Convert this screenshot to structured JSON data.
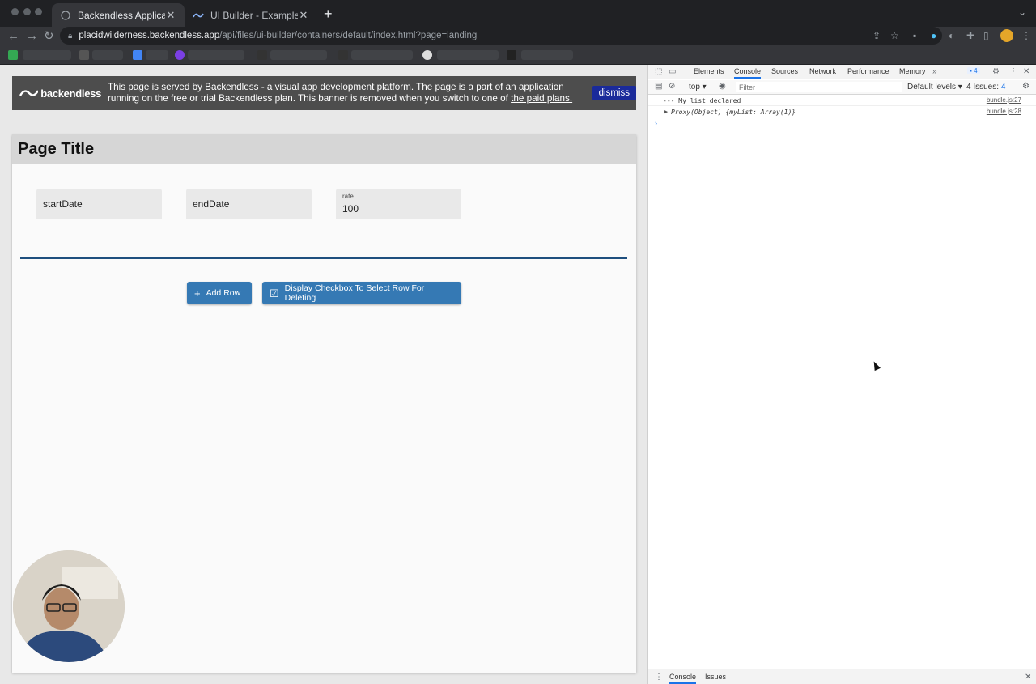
{
  "browser": {
    "tabs": [
      {
        "title": "Backendless Application",
        "active": true
      },
      {
        "title": "UI Builder - Example_for_supp",
        "active": false
      }
    ],
    "url_host": "placidwilderness.backendless.app",
    "url_path": "/api/files/ui-builder/containers/default/index.html?page=landing",
    "accent": "#35363a"
  },
  "banner": {
    "brand": "backendless",
    "text": "This page is served by Backendless - a visual app development platform. The page is a part of an application running on the free or trial Backendless plan. This banner is removed when you switch to one of",
    "link": "the paid plans.",
    "dismiss": "dismiss"
  },
  "page": {
    "title": "Page Title",
    "start_date_placeholder": "startDate",
    "end_date_placeholder": "endDate",
    "rate_label": "rate",
    "rate_value": "100",
    "add_row": "Add Row",
    "display_checkbox": "Display Checkbox To Select Row For Deleting",
    "button_color": "#3579b4"
  },
  "devtools": {
    "tabs": [
      "Elements",
      "Console",
      "Sources",
      "Network",
      "Performance",
      "Memory"
    ],
    "active_tab": "Console",
    "issues_badge": "4",
    "context": "top",
    "filter_placeholder": "Filter",
    "levels": "Default levels",
    "issues": "4 Issues:",
    "issues_count": "4",
    "console": [
      {
        "message": "--- My list declared",
        "source": "bundle.js:27"
      },
      {
        "message": "Proxy(Object) {myList: Array(1)}",
        "source": "bundle.js:28"
      }
    ],
    "drawer_tabs": [
      "Console",
      "Issues"
    ]
  }
}
